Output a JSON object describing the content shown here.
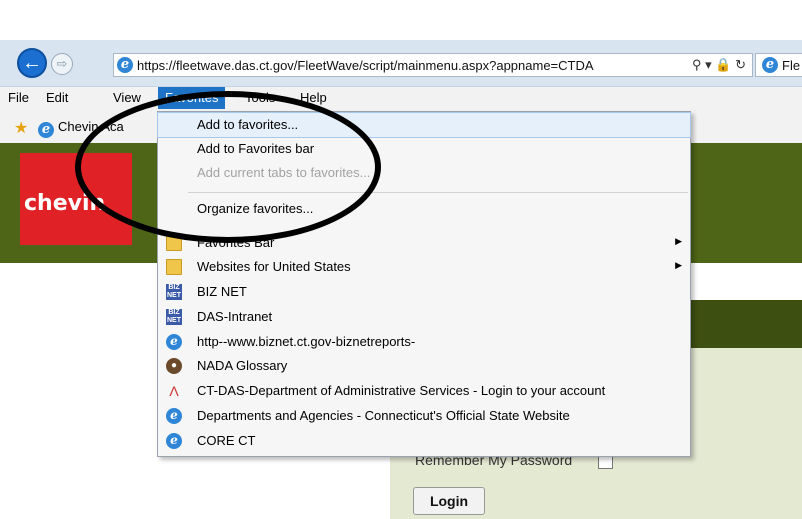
{
  "address_bar": {
    "url": "https://fleetwave.das.ct.gov/FleetWave/script/mainmenu.aspx?appname=CTDA",
    "icons": [
      "search-icon",
      "dropdown-arrow-icon",
      "lock-icon",
      "refresh-icon"
    ],
    "tab_title": "Fle"
  },
  "menu_bar": {
    "items": [
      "File",
      "Edit",
      "View",
      "Favorites",
      "Tools",
      "Help"
    ],
    "active": "Favorites"
  },
  "favorites_bar": {
    "link": "Chevin Aca"
  },
  "favorites_menu": {
    "items": [
      {
        "label": "Add to favorites...",
        "icon": "",
        "highlighted": true,
        "disabled": false,
        "submenu": false
      },
      {
        "label": "Add to Favorites bar",
        "icon": "",
        "highlighted": false,
        "disabled": false,
        "submenu": false
      },
      {
        "label": "Add current tabs to favorites...",
        "icon": "",
        "highlighted": false,
        "disabled": true,
        "submenu": false
      },
      {
        "label": "Organize favorites...",
        "icon": "",
        "highlighted": false,
        "disabled": false,
        "submenu": false
      },
      {
        "label": "Favorites Bar",
        "icon": "folder-icon",
        "highlighted": false,
        "disabled": false,
        "submenu": true
      },
      {
        "label": "Websites for United States",
        "icon": "folder-icon",
        "highlighted": false,
        "disabled": false,
        "submenu": true
      },
      {
        "label": "BIZ NET",
        "icon": "biznet-icon",
        "highlighted": false,
        "disabled": false,
        "submenu": false
      },
      {
        "label": "DAS-Intranet",
        "icon": "biznet-icon",
        "highlighted": false,
        "disabled": false,
        "submenu": false
      },
      {
        "label": "http--www.biznet.ct.gov-biznetreports-",
        "icon": "ie-icon",
        "highlighted": false,
        "disabled": false,
        "submenu": false
      },
      {
        "label": "NADA  Glossary",
        "icon": "nada-icon",
        "highlighted": false,
        "disabled": false,
        "submenu": false
      },
      {
        "label": "CT-DAS-Department of Administrative Services - Login to your account",
        "icon": "ctdas-icon",
        "highlighted": false,
        "disabled": false,
        "submenu": false
      },
      {
        "label": "Departments and Agencies - Connecticut's Official State Website",
        "icon": "ie-icon",
        "highlighted": false,
        "disabled": false,
        "submenu": false
      },
      {
        "label": "CORE CT",
        "icon": "ie-icon",
        "highlighted": false,
        "disabled": false,
        "submenu": false
      }
    ]
  },
  "page": {
    "logo_text": "chevin",
    "remember_label": "Remember My Password",
    "login_label": "Login"
  }
}
